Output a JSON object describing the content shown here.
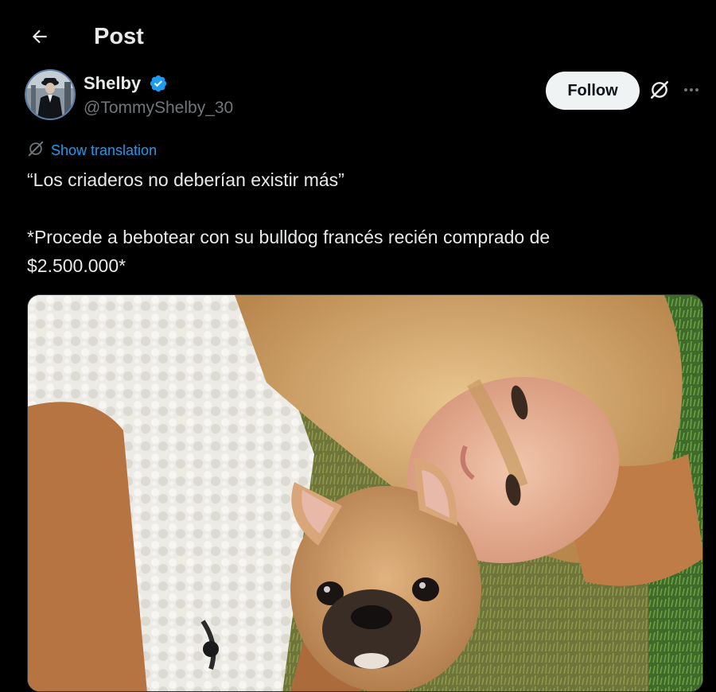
{
  "header": {
    "title": "Post",
    "back_icon": "arrow-left-icon"
  },
  "author": {
    "display_name": "Shelby",
    "handle": "@TommyShelby_30",
    "verified_color": "#1d9bf0",
    "follow_label": "Follow"
  },
  "post": {
    "translation_label": "Show translation",
    "lines": [
      "“Los criaderos no deberían existir más”",
      "*Procede a bebotear con su bulldog francés recién comprado de",
      "$2.500.000*"
    ]
  },
  "media": {
    "alt": "Woman with blonde hair lying on grass in a white fleece jacket, with a fawn French bulldog puppy"
  },
  "colors": {
    "background": "#000000",
    "text_primary": "#e7e9ea",
    "text_secondary": "#71767b",
    "accent": "#1d9bf0",
    "button_bg": "#eff3f4"
  }
}
